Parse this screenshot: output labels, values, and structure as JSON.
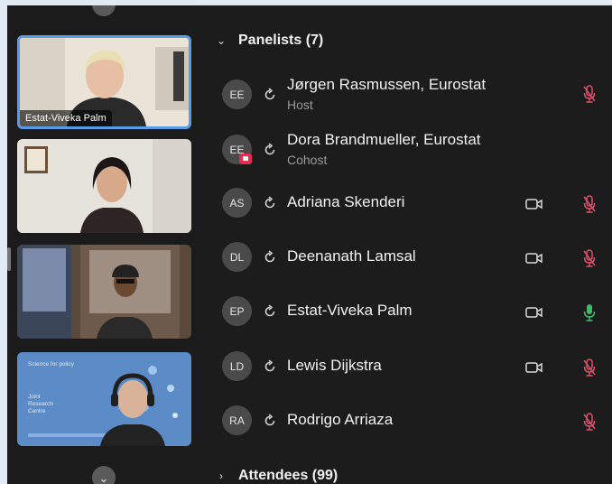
{
  "strip": {
    "tiles": [
      {
        "label": "Estat-Viveka Palm"
      },
      {
        "label": ""
      },
      {
        "label": ""
      },
      {
        "label": "",
        "slide": {
          "title": "Science for policy",
          "org": "Joint Research Centre"
        }
      }
    ]
  },
  "panelists": {
    "header": "Panelists (7)",
    "items": [
      {
        "initials": "EE",
        "name": "Jørgen Rasmussen, Eurostat",
        "role": "Host",
        "camera": false,
        "mic": "muted"
      },
      {
        "initials": "EE",
        "name": "Dora Brandmueller, Eurostat",
        "role": "Cohost",
        "camera": false,
        "mic": "none"
      },
      {
        "initials": "AS",
        "name": "Adriana Skenderi",
        "role": "",
        "camera": true,
        "mic": "muted"
      },
      {
        "initials": "DL",
        "name": "Deenanath Lamsal",
        "role": "",
        "camera": true,
        "mic": "muted"
      },
      {
        "initials": "EP",
        "name": "Estat-Viveka Palm",
        "role": "",
        "camera": true,
        "mic": "active"
      },
      {
        "initials": "LD",
        "name": "Lewis Dijkstra",
        "role": "",
        "camera": true,
        "mic": "muted"
      },
      {
        "initials": "RA",
        "name": "Rodrigo Arriaza",
        "role": "",
        "camera": false,
        "mic": "muted"
      }
    ]
  },
  "attendees": {
    "header": "Attendees (99)"
  },
  "colors": {
    "accent": "#5a9be8",
    "muted_mic": "#e0506a",
    "active_mic": "#3dbb6b"
  },
  "icons": {
    "sync": "sync-icon",
    "camera": "video-camera-icon",
    "muted": "mic-muted-icon",
    "active": "mic-icon"
  }
}
